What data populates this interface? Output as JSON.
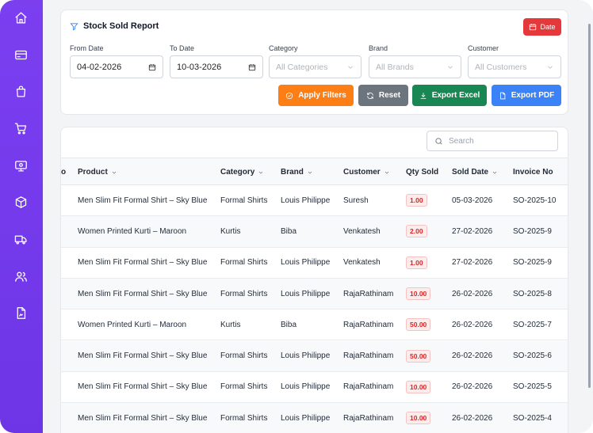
{
  "sidebar": {
    "icons": [
      "home-icon",
      "credit-card-icon",
      "shopping-bag-icon",
      "cart-icon",
      "monitor-icon",
      "box-icon",
      "truck-icon",
      "users-icon",
      "document-icon"
    ]
  },
  "report": {
    "title": "Stock Sold Report",
    "date_button": "Date"
  },
  "filters": {
    "from_date": {
      "label": "From Date",
      "value": "04-02-2026"
    },
    "to_date": {
      "label": "To Date",
      "value": "10-03-2026"
    },
    "category": {
      "label": "Category",
      "placeholder": "All Categories"
    },
    "brand": {
      "label": "Brand",
      "placeholder": "All Brands"
    },
    "customer": {
      "label": "Customer",
      "placeholder": "All Customers"
    }
  },
  "actions": {
    "apply": {
      "label": "Apply Filters",
      "color": "#fd7e14"
    },
    "reset": {
      "label": "Reset",
      "color": "#6c757d"
    },
    "excel": {
      "label": "Export Excel",
      "color": "#198754"
    },
    "pdf": {
      "label": "Export PDF",
      "color": "#3b82f6"
    }
  },
  "search": {
    "placeholder": "Search"
  },
  "table": {
    "cut_header": "o",
    "headers": [
      "Product",
      "Category",
      "Brand",
      "Customer",
      "Qty Sold",
      "Sold Date",
      "Invoice No"
    ],
    "rows": [
      {
        "product": "Men Slim Fit Formal Shirt – Sky Blue",
        "category": "Formal Shirts",
        "brand": "Louis Philippe",
        "customer": "Suresh",
        "qty": "1.00",
        "date": "05-03-2026",
        "invoice": "SO-2025-10"
      },
      {
        "product": "Women Printed Kurti – Maroon",
        "category": "Kurtis",
        "brand": "Biba",
        "customer": "Venkatesh",
        "qty": "2.00",
        "date": "27-02-2026",
        "invoice": "SO-2025-9"
      },
      {
        "product": "Men Slim Fit Formal Shirt – Sky Blue",
        "category": "Formal Shirts",
        "brand": "Louis Philippe",
        "customer": "Venkatesh",
        "qty": "1.00",
        "date": "27-02-2026",
        "invoice": "SO-2025-9"
      },
      {
        "product": "Men Slim Fit Formal Shirt – Sky Blue",
        "category": "Formal Shirts",
        "brand": "Louis Philippe",
        "customer": "RajaRathinam",
        "qty": "10.00",
        "date": "26-02-2026",
        "invoice": "SO-2025-8"
      },
      {
        "product": "Women Printed Kurti – Maroon",
        "category": "Kurtis",
        "brand": "Biba",
        "customer": "RajaRathinam",
        "qty": "50.00",
        "date": "26-02-2026",
        "invoice": "SO-2025-7"
      },
      {
        "product": "Men Slim Fit Formal Shirt – Sky Blue",
        "category": "Formal Shirts",
        "brand": "Louis Philippe",
        "customer": "RajaRathinam",
        "qty": "50.00",
        "date": "26-02-2026",
        "invoice": "SO-2025-6"
      },
      {
        "product": "Men Slim Fit Formal Shirt – Sky Blue",
        "category": "Formal Shirts",
        "brand": "Louis Philippe",
        "customer": "RajaRathinam",
        "qty": "10.00",
        "date": "26-02-2026",
        "invoice": "SO-2025-5"
      },
      {
        "product": "Men Slim Fit Formal Shirt – Sky Blue",
        "category": "Formal Shirts",
        "brand": "Louis Philippe",
        "customer": "RajaRathinam",
        "qty": "10.00",
        "date": "26-02-2026",
        "invoice": "SO-2025-4"
      }
    ]
  }
}
